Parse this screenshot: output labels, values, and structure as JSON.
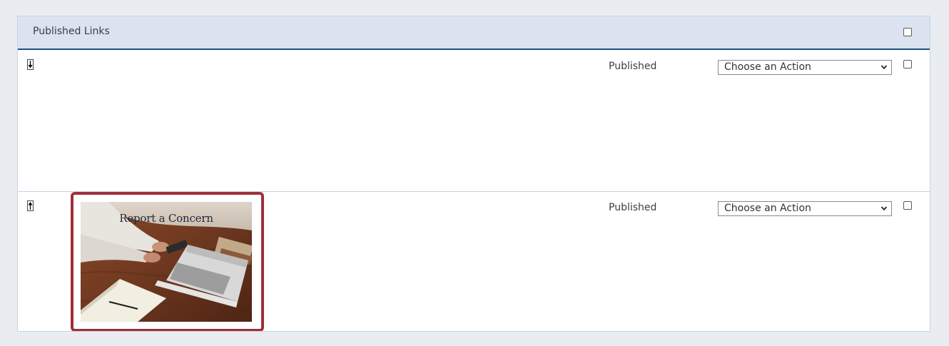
{
  "panel": {
    "title": "Published Links"
  },
  "rows": [
    {
      "move_direction": "down",
      "status": "Published",
      "action_select": "Choose an Action",
      "has_image": false
    },
    {
      "move_direction": "up",
      "status": "Published",
      "action_select": "Choose an Action",
      "has_image": true,
      "image_title": "Report a Concern"
    }
  ],
  "colors": {
    "header_bg": "#dae3ef",
    "header_rule": "#1f4e8a",
    "highlight_border": "#9e2f3c",
    "page_bg": "#e9edf1"
  }
}
